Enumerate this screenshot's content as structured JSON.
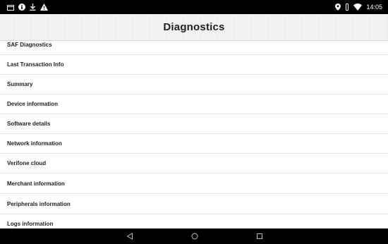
{
  "status_bar": {
    "time": "14:05",
    "left_icons": [
      "calendar-icon",
      "info-icon",
      "download-icon",
      "warning-icon"
    ],
    "right_icons": [
      "location-icon",
      "vibrate-icon",
      "wifi-icon"
    ]
  },
  "app_bar": {
    "title": "Diagnostics"
  },
  "menu": {
    "items": [
      {
        "label": "SAF Diagnostics"
      },
      {
        "label": "Last Transaction Info"
      },
      {
        "label": "Summary"
      },
      {
        "label": "Device information"
      },
      {
        "label": "Software details"
      },
      {
        "label": "Network information"
      },
      {
        "label": "Verifone cloud"
      },
      {
        "label": "Merchant information"
      },
      {
        "label": "Peripherals information"
      },
      {
        "label": "Logs information"
      }
    ]
  },
  "nav_bar": {
    "icons": [
      "back-icon",
      "home-icon",
      "recents-icon"
    ]
  },
  "colors": {
    "status_bar": "#000000",
    "app_bar": "#f3f3f3",
    "text": "#1e1e1e",
    "divider": "#e2e2e2"
  }
}
